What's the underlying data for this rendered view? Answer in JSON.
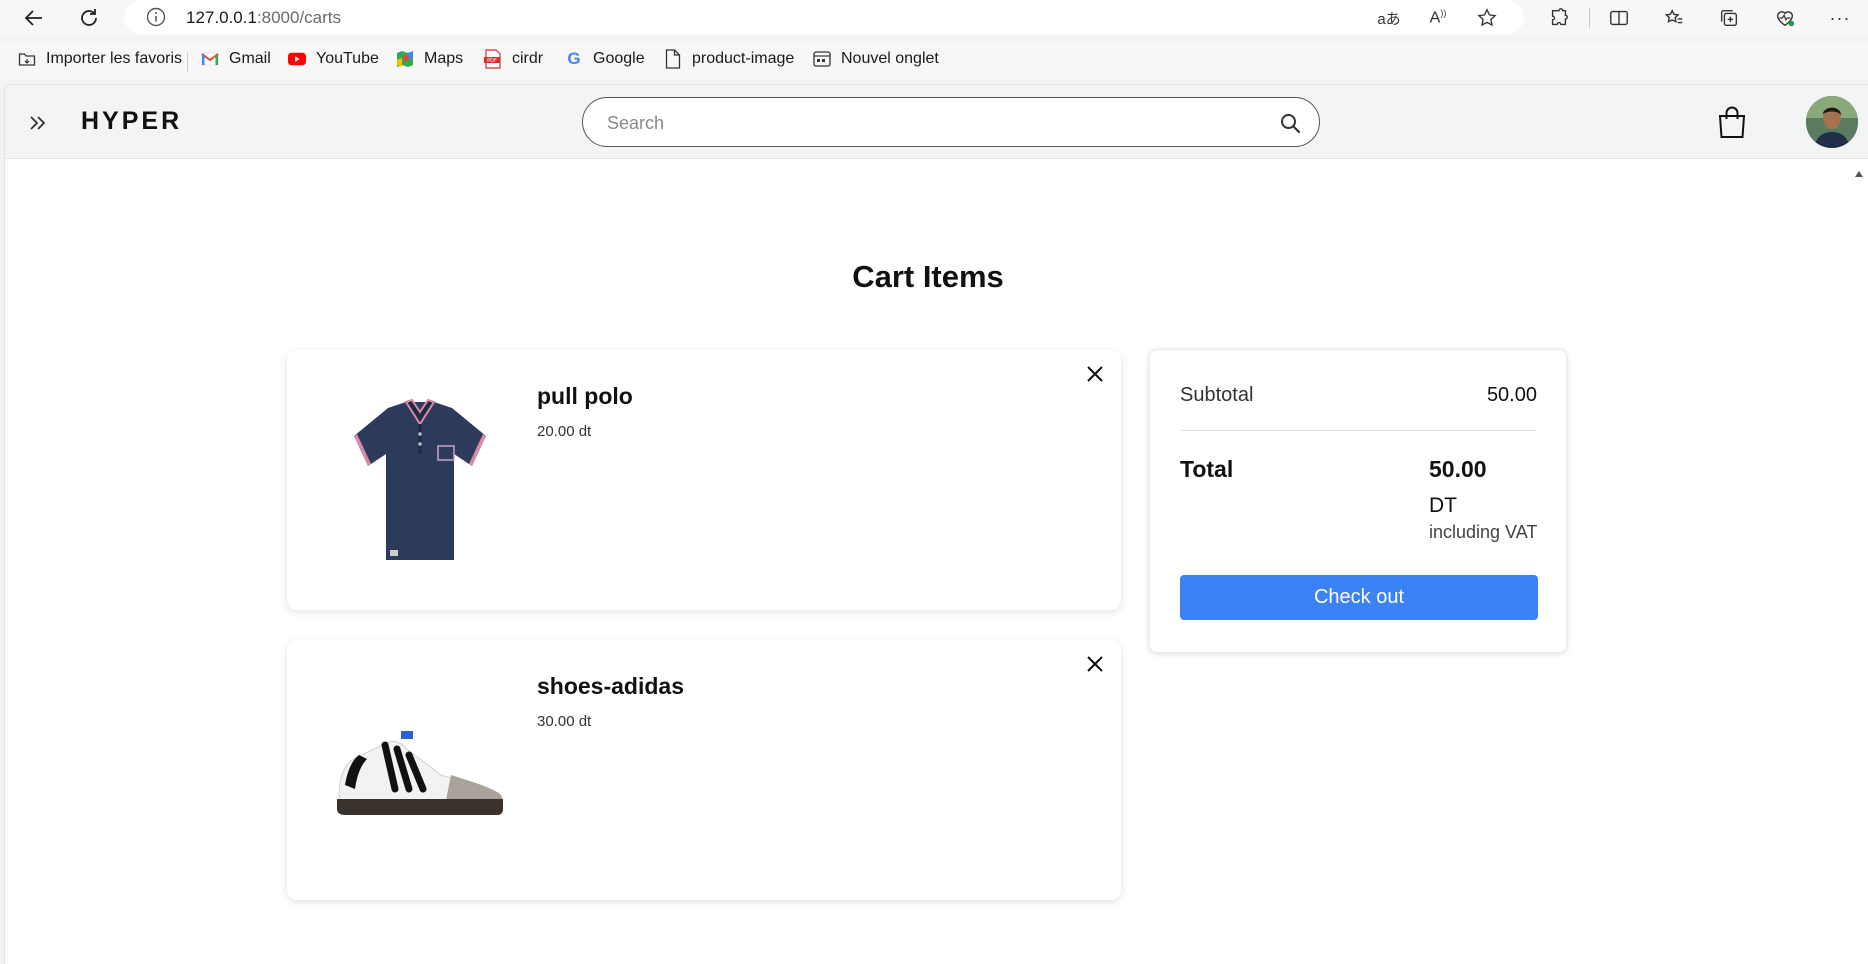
{
  "browser": {
    "url_host": "127.0.0.1",
    "url_path": ":8000/carts",
    "bookmarks": [
      {
        "label": "Importer les favoris",
        "icon": "folder-import-icon"
      },
      {
        "label": "Gmail",
        "icon": "gmail-icon"
      },
      {
        "label": "YouTube",
        "icon": "youtube-icon"
      },
      {
        "label": "Maps",
        "icon": "maps-icon"
      },
      {
        "label": "cirdr",
        "icon": "pdf-icon"
      },
      {
        "label": "Google",
        "icon": "google-icon"
      },
      {
        "label": "product-image",
        "icon": "document-icon"
      },
      {
        "label": "Nouvel onglet",
        "icon": "new-tab-icon"
      }
    ]
  },
  "header": {
    "brand": "HYPER",
    "search_placeholder": "Search"
  },
  "page": {
    "title": "Cart Items"
  },
  "cart": {
    "items": [
      {
        "name": "pull polo",
        "price": "20.00 dt",
        "image": "navy polo shirt"
      },
      {
        "name": "shoes-adidas",
        "price": "30.00 dt",
        "image": "white adidas sneaker"
      }
    ]
  },
  "summary": {
    "subtotal_label": "Subtotal",
    "subtotal_value": "50.00",
    "total_label": "Total",
    "total_value": "50.00",
    "currency": "DT",
    "vat_note": "including VAT",
    "checkout_label": "Check out"
  },
  "colors": {
    "accent": "#3b82f6",
    "header_bg": "#f3f4f6"
  }
}
